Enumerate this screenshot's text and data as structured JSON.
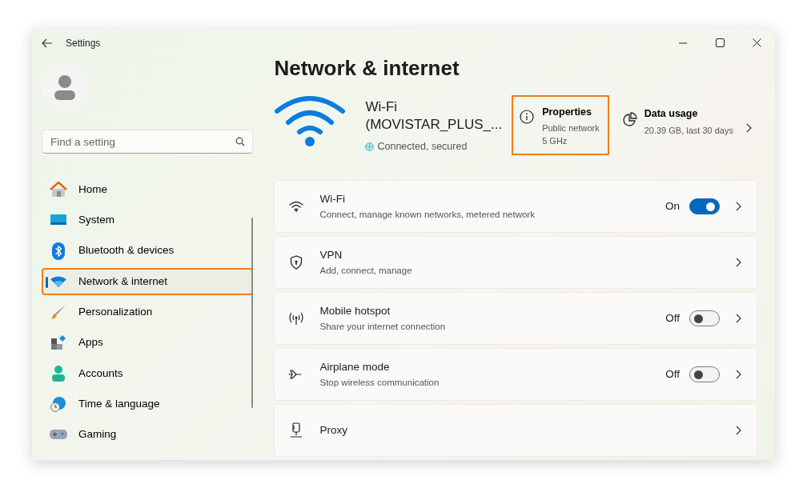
{
  "window": {
    "title": "Settings"
  },
  "search": {
    "placeholder": "Find a setting"
  },
  "sidebar": {
    "items": [
      {
        "label": "Home",
        "selected": false,
        "highlighted": false
      },
      {
        "label": "System",
        "selected": false,
        "highlighted": false
      },
      {
        "label": "Bluetooth & devices",
        "selected": false,
        "highlighted": false
      },
      {
        "label": "Network & internet",
        "selected": true,
        "highlighted": true
      },
      {
        "label": "Personalization",
        "selected": false,
        "highlighted": false
      },
      {
        "label": "Apps",
        "selected": false,
        "highlighted": false
      },
      {
        "label": "Accounts",
        "selected": false,
        "highlighted": false
      },
      {
        "label": "Time & language",
        "selected": false,
        "highlighted": false
      },
      {
        "label": "Gaming",
        "selected": false,
        "highlighted": false
      }
    ]
  },
  "page_title": "Network & internet",
  "connection": {
    "name": "Wi-Fi",
    "ssid": "(MOVISTAR_PLUS_...",
    "status": "Connected, secured"
  },
  "properties": {
    "title": "Properties",
    "lines": [
      "Public network",
      "5 GHz"
    ],
    "highlighted": true
  },
  "data_usage": {
    "title": "Data usage",
    "detail": "20.39 GB, last 30 days"
  },
  "settings": [
    {
      "kind": "toggle",
      "title": "Wi-Fi",
      "subtitle": "Connect, manage known networks, metered network",
      "state_label": "On",
      "on": true
    },
    {
      "kind": "link",
      "title": "VPN",
      "subtitle": "Add, connect, manage"
    },
    {
      "kind": "toggle",
      "title": "Mobile hotspot",
      "subtitle": "Share your internet connection",
      "state_label": "Off",
      "on": false
    },
    {
      "kind": "toggle",
      "title": "Airplane mode",
      "subtitle": "Stop wireless communication",
      "state_label": "Off",
      "on": false
    },
    {
      "kind": "link",
      "title": "Proxy"
    }
  ]
}
